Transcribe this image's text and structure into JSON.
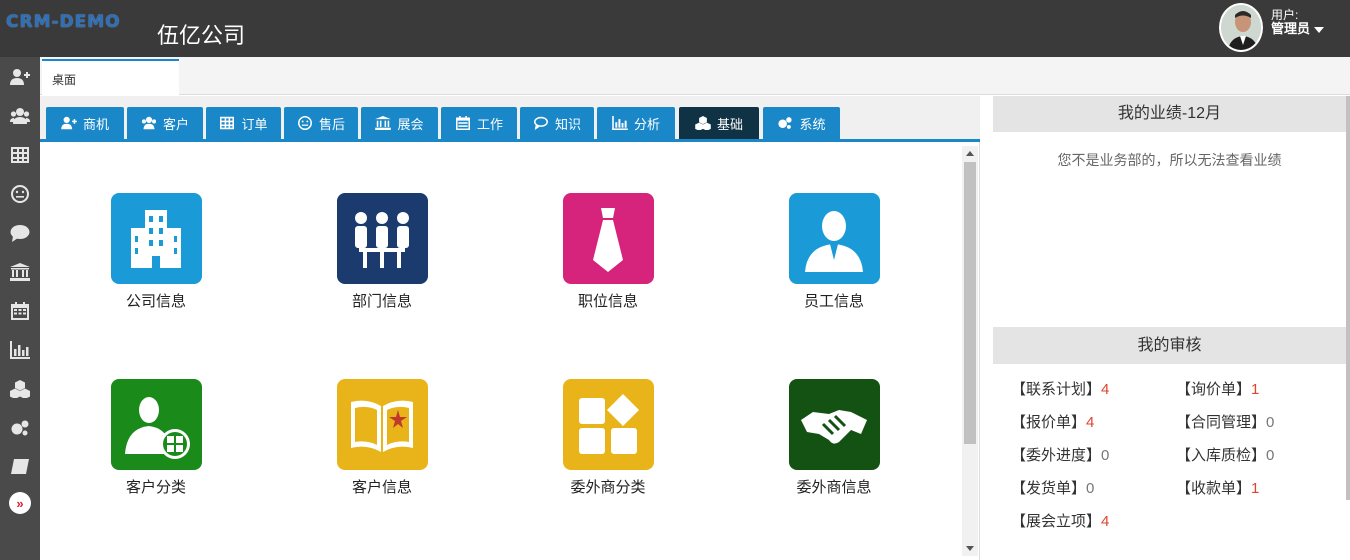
{
  "header": {
    "logo_text": "CRM-DEMO",
    "company_name": "伍亿公司",
    "user_label": "用户:",
    "user_name": "管理员"
  },
  "sidebar": {
    "icons": [
      "add-user-icon",
      "users-icon",
      "table-icon",
      "smile-icon",
      "chat-icon",
      "bank-icon",
      "calendar-icon",
      "bar-chart-icon",
      "cubes-icon",
      "gears-icon",
      "book-icon"
    ],
    "expand_label": "»"
  },
  "page_tabs": [
    {
      "label": "桌面"
    }
  ],
  "nav_tabs": [
    {
      "label": "商机",
      "icon": "add-user-icon"
    },
    {
      "label": "客户",
      "icon": "users-icon"
    },
    {
      "label": "订单",
      "icon": "table-icon"
    },
    {
      "label": "售后",
      "icon": "smile-icon"
    },
    {
      "label": "展会",
      "icon": "bank-icon"
    },
    {
      "label": "工作",
      "icon": "calendar-icon"
    },
    {
      "label": "知识",
      "icon": "chat-icon"
    },
    {
      "label": "分析",
      "icon": "bar-chart-icon"
    },
    {
      "label": "基础",
      "icon": "cubes-icon",
      "active": true
    },
    {
      "label": "系统",
      "icon": "gears-icon"
    }
  ],
  "tiles": [
    {
      "label": "公司信息",
      "color": "#1a9ad6",
      "icon": "building-icon"
    },
    {
      "label": "部门信息",
      "color": "#1b3a6e",
      "icon": "meeting-icon"
    },
    {
      "label": "职位信息",
      "color": "#d6237c",
      "icon": "tie-icon"
    },
    {
      "label": "员工信息",
      "color": "#1a9ad6",
      "icon": "person-icon"
    },
    {
      "label": "客户分类",
      "color": "#1a8a1a",
      "icon": "user-category-icon"
    },
    {
      "label": "客户信息",
      "color": "#e9b41a",
      "icon": "open-book-icon"
    },
    {
      "label": "委外商分类",
      "color": "#e9b41a",
      "icon": "shapes-icon"
    },
    {
      "label": "委外商信息",
      "color": "#145214",
      "icon": "handshake-icon"
    }
  ],
  "performance": {
    "title": "我的业绩-12月",
    "message": "您不是业务部的，所以无法查看业绩"
  },
  "review": {
    "title": "我的审核",
    "items": [
      {
        "label": "【联系计划】",
        "count": "4",
        "highlight": true
      },
      {
        "label": "【询价单】",
        "count": "1",
        "highlight": true
      },
      {
        "label": "【报价单】",
        "count": "4",
        "highlight": true
      },
      {
        "label": "【合同管理】",
        "count": "0",
        "highlight": false
      },
      {
        "label": "【委外进度】",
        "count": "0",
        "highlight": false
      },
      {
        "label": "【入库质检】",
        "count": "0",
        "highlight": false
      },
      {
        "label": "【发货单】",
        "count": "0",
        "highlight": false
      },
      {
        "label": "【收款单】",
        "count": "1",
        "highlight": true
      },
      {
        "label": "【展会立项】",
        "count": "4",
        "highlight": true
      }
    ]
  }
}
